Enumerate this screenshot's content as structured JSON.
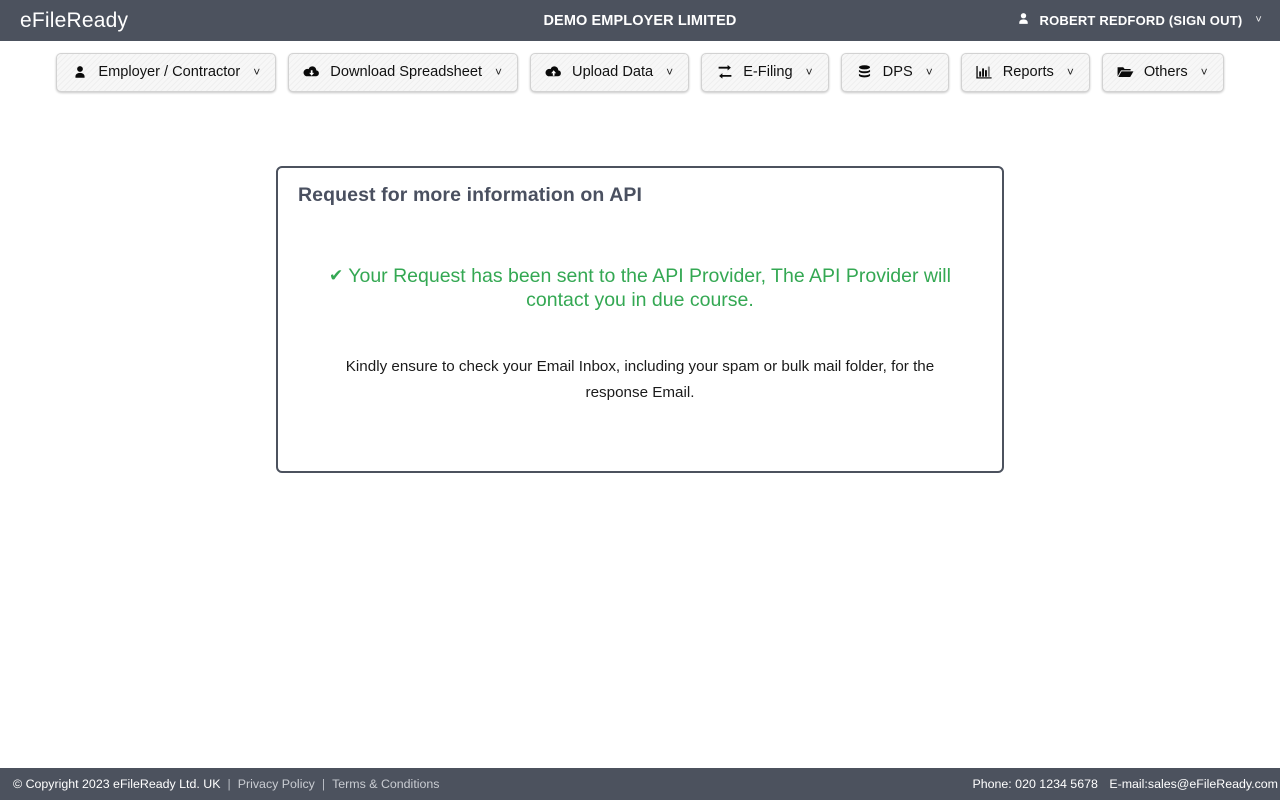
{
  "header": {
    "brand": "eFileReady",
    "company": "DEMO EMPLOYER LIMITED",
    "user_label": "ROBERT REDFORD (SIGN OUT)",
    "user_icon": "user-icon",
    "caret": "˅",
    "background": "#4c525e"
  },
  "nav": {
    "items": [
      {
        "label": "Employer / Contractor",
        "icon": "user-icon",
        "caret": "˅"
      },
      {
        "label": "Download Spreadsheet",
        "icon": "cloud-download-icon",
        "caret": "˅"
      },
      {
        "label": "Upload Data",
        "icon": "cloud-upload-icon",
        "caret": "˅"
      },
      {
        "label": "E-Filing",
        "icon": "exchange-arrows-icon",
        "caret": "˅"
      },
      {
        "label": "DPS",
        "icon": "database-icon",
        "caret": "˅"
      },
      {
        "label": "Reports",
        "icon": "bar-chart-icon",
        "caret": "˅"
      },
      {
        "label": "Others",
        "icon": "folder-open-icon",
        "caret": "˅"
      }
    ]
  },
  "panel": {
    "title": "Request for more information on API",
    "success_icon": "check-mark-icon",
    "success_message": "Your Request has been sent to the API Provider, The API Provider will contact you in due course.",
    "note_message": "Kindly ensure to check your Email Inbox, including your spam or bulk mail folder, for the response Email.",
    "success_color": "#34a853",
    "border_color": "#4c525e"
  },
  "footer": {
    "copyright": "© Copyright 2023  eFileReady Ltd. UK",
    "separator": "|",
    "privacy_policy": "Privacy Policy",
    "terms": "Terms & Conditions",
    "phone": "Phone: 020 1234 5678",
    "email": "E-mail:sales@eFileReady.com",
    "background": "#4c525e"
  }
}
